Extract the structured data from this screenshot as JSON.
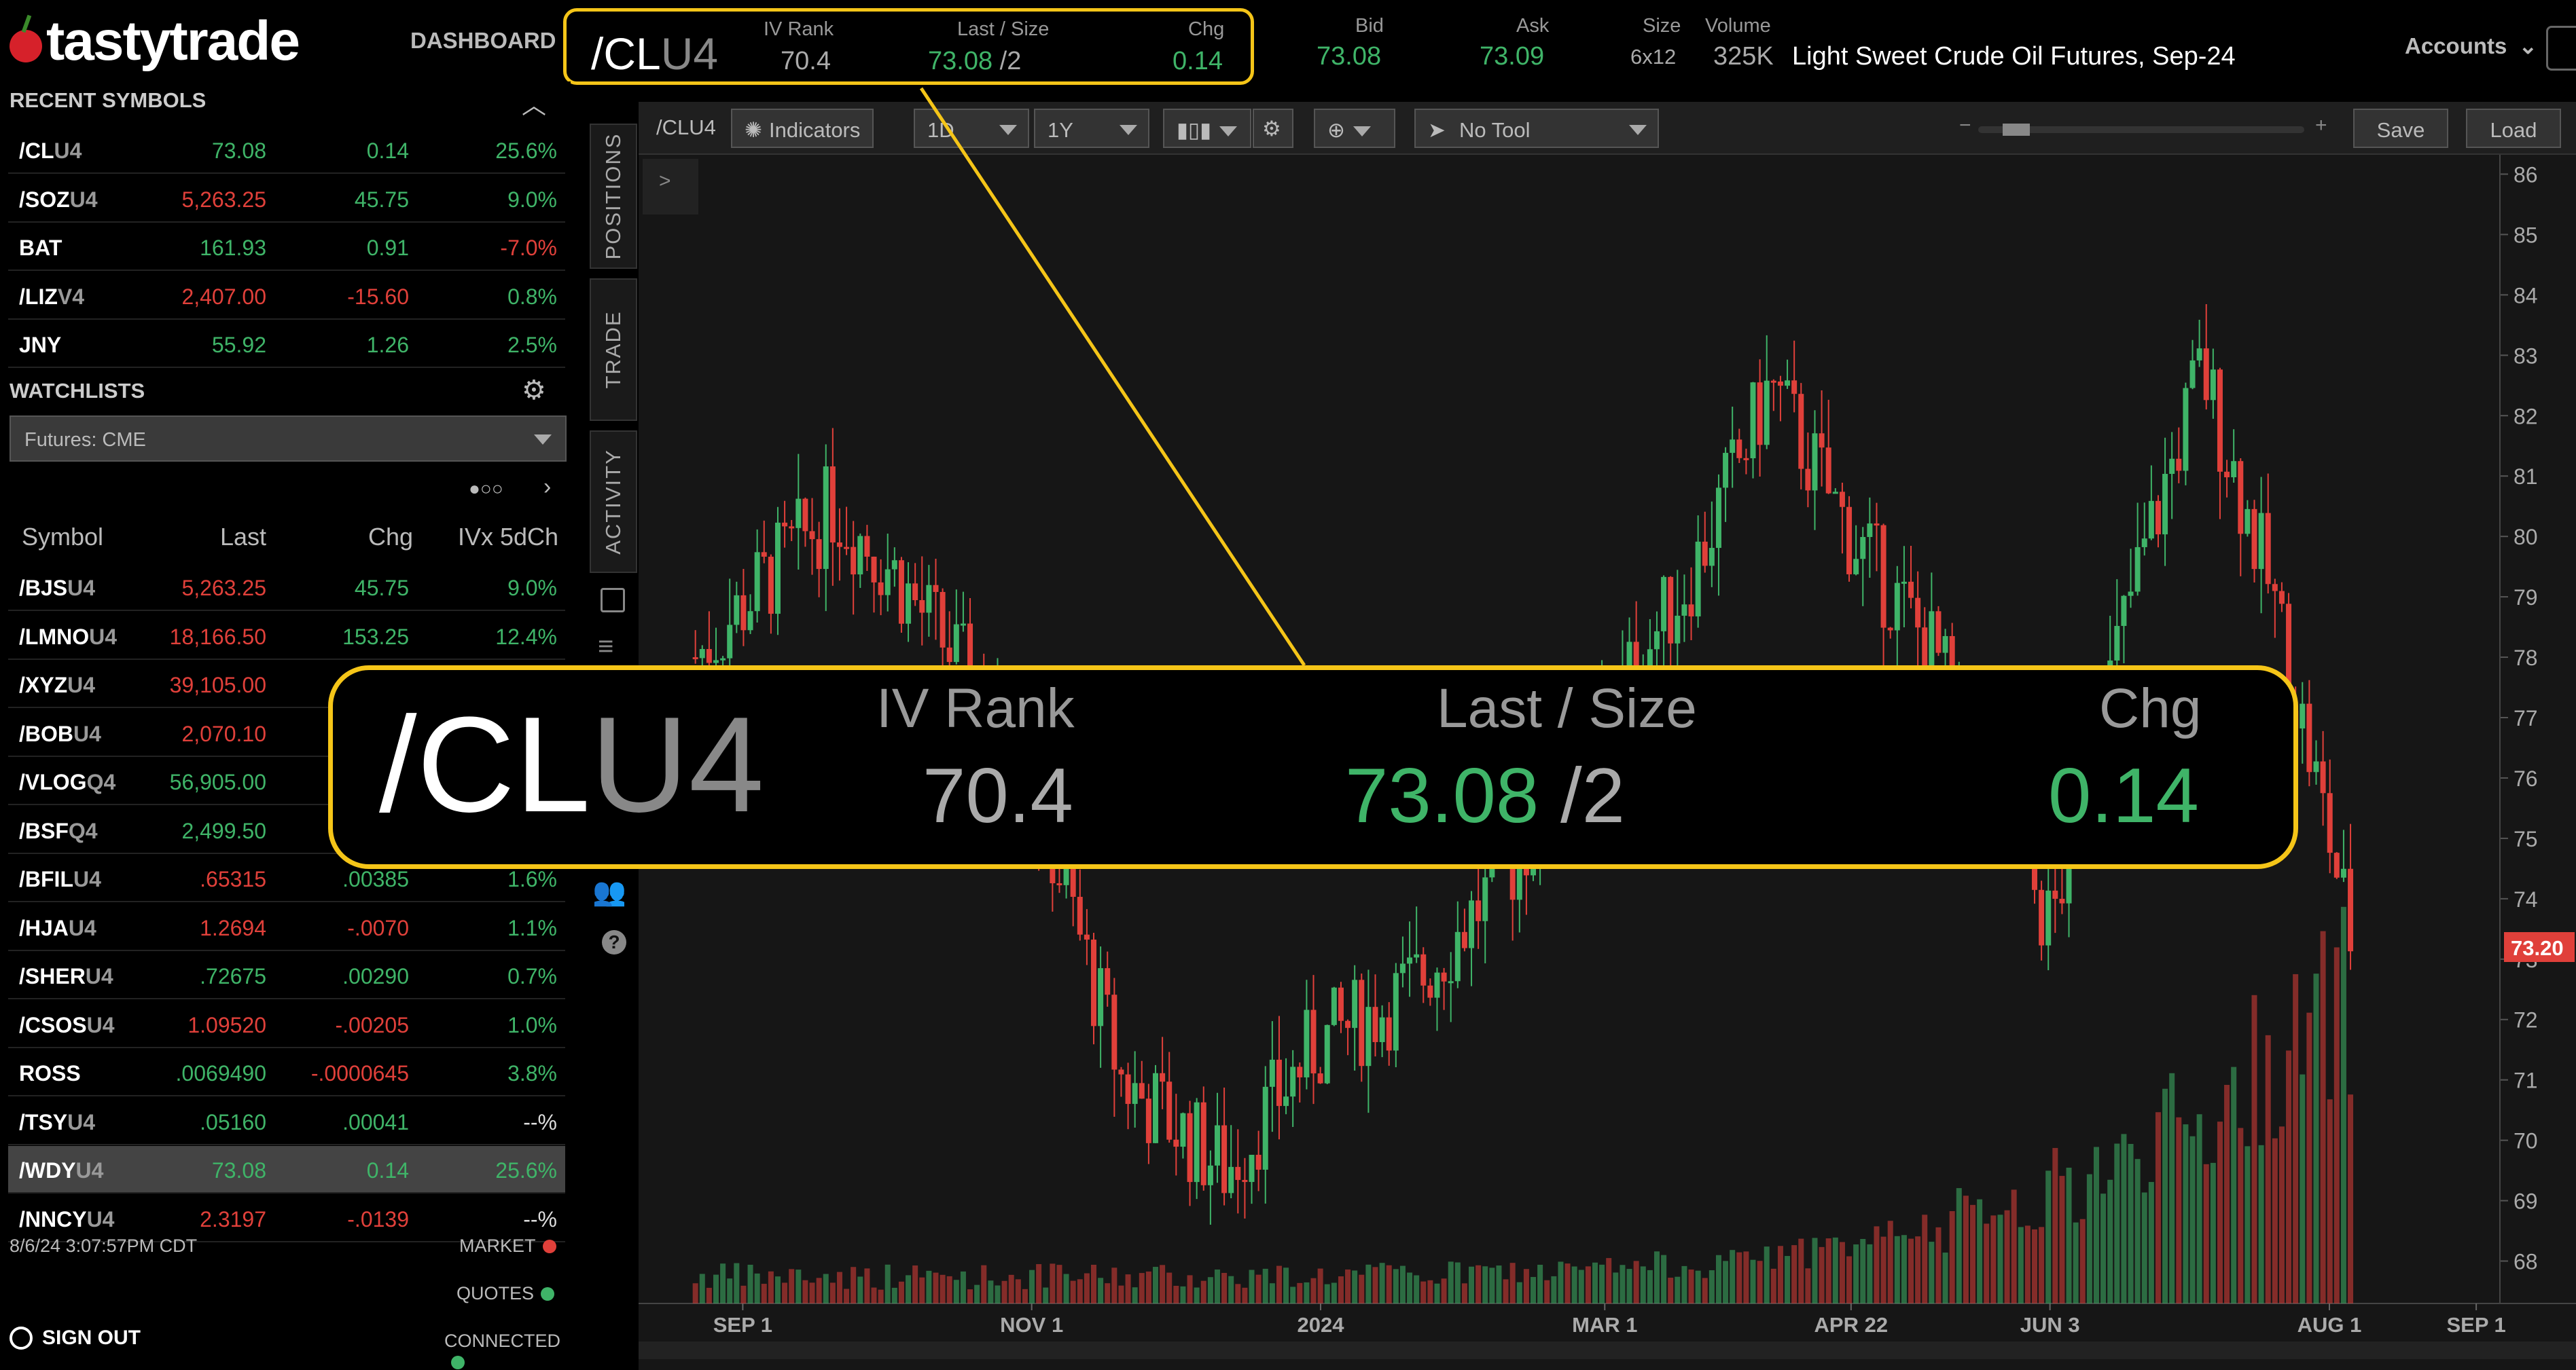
{
  "header": {
    "logo": "tastytrade",
    "dashboard": "DASHBOARD",
    "symbol_main": "/CL",
    "symbol_suffix": "U4",
    "iv_rank_label": "IV Rank",
    "iv_rank": "70.4",
    "last_size_label": "Last / Size",
    "last": "73.08",
    "size": "/2",
    "chg_label": "Chg",
    "chg": "0.14",
    "bid_label": "Bid",
    "bid": "73.08",
    "ask_label": "Ask",
    "ask": "73.09",
    "size_label": "Size",
    "size_val": "6x12",
    "volume_label": "Volume",
    "volume": "325K",
    "description": "Light Sweet Crude Oil Futures, Sep-24",
    "accounts": "Accounts"
  },
  "recent": {
    "title": "RECENT SYMBOLS",
    "rows": [
      {
        "sym": "/CL",
        "suf": "U4",
        "last": "73.08",
        "chg": "0.14",
        "pct": "25.6%",
        "lc": "green",
        "cc": "green",
        "pc": "green"
      },
      {
        "sym": "/SOZ",
        "suf": "U4",
        "last": "5,263.25",
        "chg": "45.75",
        "pct": "9.0%",
        "lc": "red",
        "cc": "green",
        "pc": "green"
      },
      {
        "sym": "BAT",
        "suf": "",
        "last": "161.93",
        "chg": "0.91",
        "pct": "-7.0%",
        "lc": "green",
        "cc": "green",
        "pc": "red"
      },
      {
        "sym": "/LIZ",
        "suf": "V4",
        "last": "2,407.00",
        "chg": "-15.60",
        "pct": "0.8%",
        "lc": "red",
        "cc": "red",
        "pc": "green"
      },
      {
        "sym": "JNY",
        "suf": "",
        "last": "55.92",
        "chg": "1.26",
        "pct": "2.5%",
        "lc": "green",
        "cc": "green",
        "pc": "green"
      }
    ]
  },
  "watchlists": {
    "title": "WATCHLISTS",
    "selected": "Futures: CME",
    "col_symbol": "Symbol",
    "col_last": "Last",
    "col_chg": "Chg",
    "col_ivx": "IVx 5dCh",
    "rows": [
      {
        "sym": "/BJS",
        "suf": "U4",
        "last": "5,263.25",
        "chg": "45.75",
        "pct": "9.0%",
        "lc": "red",
        "cc": "green",
        "pc": "green"
      },
      {
        "sym": "/LMNO",
        "suf": "U4",
        "last": "18,166.50",
        "chg": "153.25",
        "pct": "12.4%",
        "lc": "red",
        "cc": "green",
        "pc": "green"
      },
      {
        "sym": "/XYZ",
        "suf": "U4",
        "last": "39,105.00",
        "chg": "",
        "pct": "",
        "lc": "red",
        "cc": "green",
        "pc": "green"
      },
      {
        "sym": "/BOB",
        "suf": "U4",
        "last": "2,070.10",
        "chg": "",
        "pct": "",
        "lc": "red",
        "cc": "green",
        "pc": "green"
      },
      {
        "sym": "/VLOG",
        "suf": "Q4",
        "last": "56,905.00",
        "chg": "",
        "pct": "",
        "lc": "green",
        "cc": "green",
        "pc": "green"
      },
      {
        "sym": "/BSF",
        "suf": "Q4",
        "last": "2,499.50",
        "chg": "",
        "pct": "",
        "lc": "green",
        "cc": "green",
        "pc": "green"
      },
      {
        "sym": "/BFIL",
        "suf": "U4",
        "last": ".65315",
        "chg": ".00385",
        "pct": "1.6%",
        "lc": "red",
        "cc": "green",
        "pc": "green"
      },
      {
        "sym": "/HJA",
        "suf": "U4",
        "last": "1.2694",
        "chg": "-.0070",
        "pct": "1.1%",
        "lc": "red",
        "cc": "red",
        "pc": "green"
      },
      {
        "sym": "/SHER",
        "suf": "U4",
        "last": ".72675",
        "chg": ".00290",
        "pct": "0.7%",
        "lc": "green",
        "cc": "green",
        "pc": "green"
      },
      {
        "sym": "/CSOS",
        "suf": "U4",
        "last": "1.09520",
        "chg": "-.00205",
        "pct": "1.0%",
        "lc": "red",
        "cc": "red",
        "pc": "green"
      },
      {
        "sym": "ROSS",
        "suf": "",
        "last": ".0069490",
        "chg": "-.0000645",
        "pct": "3.8%",
        "lc": "green",
        "cc": "red",
        "pc": "green"
      },
      {
        "sym": "/TSY",
        "suf": "U4",
        "last": ".05160",
        "chg": ".00041",
        "pct": "--%",
        "lc": "green",
        "cc": "green",
        "pc": "white"
      },
      {
        "sym": "/WDY",
        "suf": "U4",
        "last": "73.08",
        "chg": "0.14",
        "pct": "25.6%",
        "lc": "green",
        "cc": "green",
        "pc": "green"
      },
      {
        "sym": "/NNCY",
        "suf": "U4",
        "last": "2.3197",
        "chg": "-.0139",
        "pct": "--%",
        "lc": "red",
        "cc": "red",
        "pc": "white"
      }
    ]
  },
  "footer": {
    "timestamp": "8/6/24 3:07:57PM CDT",
    "market": "MARKET",
    "quotes": "QUOTES",
    "connected": "CONNECTED",
    "signout": "SIGN OUT"
  },
  "tabs": {
    "positions": "POSITIONS",
    "trade": "TRADE",
    "activity": "ACTIVITY"
  },
  "toolbar": {
    "symbol": "/CLU4",
    "indicators": "Indicators",
    "interval": "1D",
    "range": "1Y",
    "tool": "No Tool",
    "save": "Save",
    "load": "Load",
    "expand": ">"
  },
  "colors": {
    "up": "#3fb468",
    "down": "#e0403a",
    "accent": "#f5c518",
    "price_tag": "#e0403a"
  },
  "chart_data": {
    "type": "candlestick",
    "current_price": "73.20",
    "y_ticks": [
      "86",
      "85",
      "84",
      "83",
      "82",
      "81",
      "80",
      "79",
      "78",
      "77",
      "76",
      "75",
      "74",
      "73",
      "72",
      "71",
      "70",
      "69",
      "68"
    ],
    "x_ticks": [
      "SEP 1",
      "NOV 1",
      "2024",
      "MAR 1",
      "APR 22",
      "JUN 3",
      "AUG 1",
      "SEP 1"
    ],
    "ylim": [
      67.5,
      86.5
    ],
    "close_path": [
      {
        "x": "2023-08-22",
        "close": 78
      },
      {
        "x": "2023-09-20",
        "close": 80.5
      },
      {
        "x": "2023-10-02",
        "close": 79.5
      },
      {
        "x": "2023-10-20",
        "close": 77.5
      },
      {
        "x": "2023-11-01",
        "close": 76
      },
      {
        "x": "2023-11-20",
        "close": 71
      },
      {
        "x": "2023-12-12",
        "close": 69.5
      },
      {
        "x": "2023-12-30",
        "close": 71.5
      },
      {
        "x": "2024-01-20",
        "close": 72.5
      },
      {
        "x": "2024-02-10",
        "close": 74.5
      },
      {
        "x": "2024-03-01",
        "close": 77
      },
      {
        "x": "2024-03-20",
        "close": 79.5
      },
      {
        "x": "2024-04-05",
        "close": 82.5
      },
      {
        "x": "2024-04-22",
        "close": 80
      },
      {
        "x": "2024-05-10",
        "close": 78
      },
      {
        "x": "2024-06-03",
        "close": 73.5
      },
      {
        "x": "2024-06-20",
        "close": 79
      },
      {
        "x": "2024-07-05",
        "close": 82.8
      },
      {
        "x": "2024-07-20",
        "close": 79
      },
      {
        "x": "2024-08-01",
        "close": 75
      },
      {
        "x": "2024-08-06",
        "close": 73.2
      }
    ]
  }
}
